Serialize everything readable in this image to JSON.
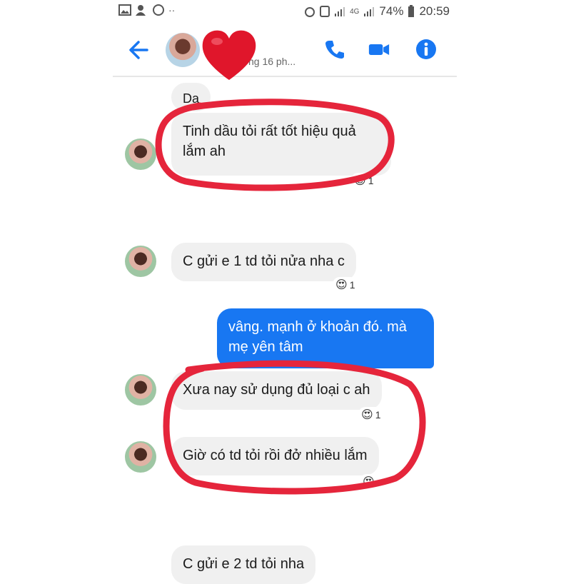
{
  "status_bar": {
    "battery": "74%",
    "time": "20:59",
    "network": "4G"
  },
  "header": {
    "active_text": "ng 16 ph...",
    "back_icon": "arrow-left-icon",
    "call_icon": "phone-icon",
    "video_icon": "video-camera-icon",
    "info_icon": "info-icon",
    "accent_color": "#1877f2"
  },
  "messages": [
    {
      "text": "Da",
      "direction": "in"
    },
    {
      "text": "Tinh dầu tỏi rất tốt hiệu quả lắm ah",
      "direction": "in",
      "reaction": "1"
    },
    {
      "text": "C gửi e 1 td tỏi nửa nha c",
      "direction": "in",
      "reaction": "1"
    },
    {
      "text": "vâng. mạnh ở khoản đó. mà mẹ yên tâm",
      "direction": "out"
    },
    {
      "text": "Xưa nay sử dụng đủ loại c ah",
      "direction": "in",
      "reaction": "1"
    },
    {
      "text": "Giờ có td tỏi rồi đở nhiều lắm",
      "direction": "in",
      "reaction": ""
    },
    {
      "text": "C gửi e 2 td tỏi nha",
      "direction": "in"
    }
  ],
  "overlay": {
    "heart_color": "#e0162b",
    "circle_color": "#e5253b"
  }
}
